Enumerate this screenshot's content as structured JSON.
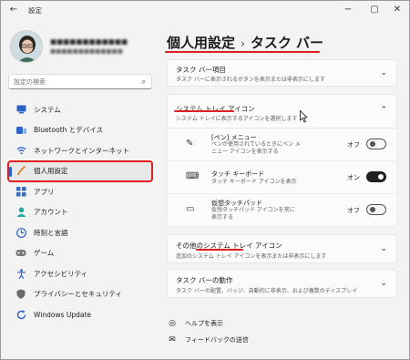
{
  "window": {
    "app_title": "設定",
    "back_icon": "arrow-left-icon"
  },
  "user": {
    "name": "■■■■■■■■■■■■",
    "email": "■■■■■■■■■■■■■"
  },
  "search": {
    "placeholder": "設定の検索"
  },
  "sidebar": {
    "items": [
      {
        "label": "システム",
        "icon": "monitor-icon",
        "color": "#2a64c8"
      },
      {
        "label": "Bluetooth とデバイス",
        "icon": "bluetooth-icon",
        "color": "#2a64c8"
      },
      {
        "label": "ネットワークとインターネット",
        "icon": "wifi-icon",
        "color": "#2a64c8"
      },
      {
        "label": "個人用設定",
        "icon": "brush-icon",
        "color": "#d9822b",
        "active": true
      },
      {
        "label": "アプリ",
        "icon": "apps-icon",
        "color": "#3a6db5"
      },
      {
        "label": "アカウント",
        "icon": "person-icon",
        "color": "#2aa6a0"
      },
      {
        "label": "時刻と言語",
        "icon": "globe-clock-icon",
        "color": "#2a64c8"
      },
      {
        "label": "ゲーム",
        "icon": "gamepad-icon",
        "color": "#7a7a7a"
      },
      {
        "label": "アクセシビリティ",
        "icon": "accessibility-icon",
        "color": "#2a64c8"
      },
      {
        "label": "プライバシーとセキュリティ",
        "icon": "shield-icon",
        "color": "#6b6b6b"
      },
      {
        "label": "Windows Update",
        "icon": "update-icon",
        "color": "#2a64c8"
      }
    ]
  },
  "breadcrumb": {
    "parent": "個人用設定",
    "separator": "›",
    "current": "タスク バー"
  },
  "sections": {
    "taskbar_items": {
      "title": "タスク バー項目",
      "subtitle": "タスク バーに表示されるボタンを表示または非表示にします"
    },
    "system_tray": {
      "title": "システム トレイ アイコン",
      "subtitle": "システム トレイに表示するアイコンを選択します"
    },
    "tray_items": [
      {
        "title": "[ペン] メニュー",
        "subtitle_1": "ペンが使用されているときにペン メ",
        "subtitle_2": "ニュー アイコンを表示する",
        "state": "オフ",
        "on": false,
        "icon": "pen-icon"
      },
      {
        "title": "タッチ キーボード",
        "subtitle_1": "タッチ キーボード アイコンを表示",
        "subtitle_2": "",
        "state": "オン",
        "on": true,
        "icon": "keyboard-icon"
      },
      {
        "title": "仮想タッチパッド",
        "subtitle_1": "仮想タッチパッド アイコンを常に",
        "subtitle_2": "表示する",
        "state": "オフ",
        "on": false,
        "icon": "touchpad-icon"
      }
    ],
    "other_tray": {
      "title": "その他のシステム トレイ アイコン",
      "subtitle": "追加のシステム トレイ アイコンを表示または非表示にします"
    },
    "behavior": {
      "title": "タスク バーの動作",
      "subtitle": "タスク バーの配置、バッジ、自動的に非表示、および複数のディスプレイ"
    }
  },
  "links": {
    "help": "ヘルプを表示",
    "feedback": "フィードバックの送信"
  },
  "colors": {
    "accent": "#2a64c8",
    "highlight": "#e02020"
  }
}
